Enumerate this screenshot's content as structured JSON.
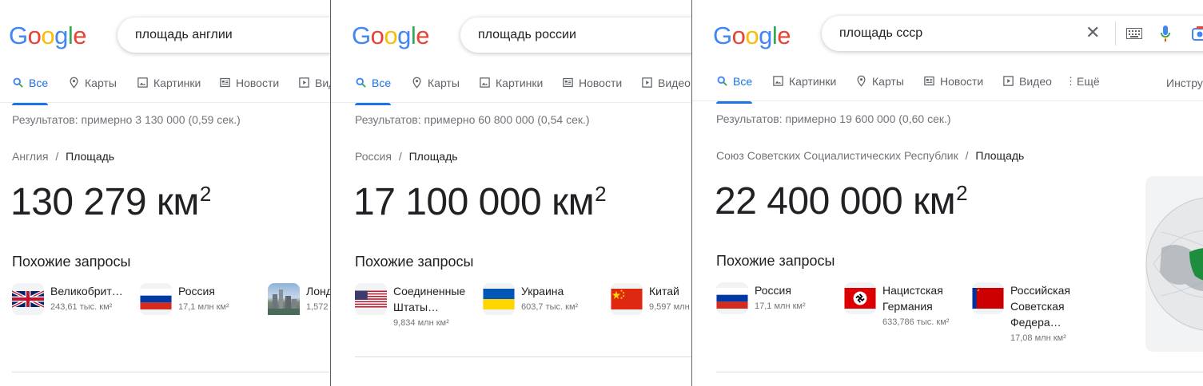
{
  "logo": {
    "letters": [
      "G",
      "o",
      "o",
      "g",
      "l",
      "e"
    ],
    "colors": [
      "#4285F4",
      "#EA4335",
      "#FBBC05",
      "#4285F4",
      "#34A853",
      "#EA4335"
    ]
  },
  "panels": [
    {
      "query": "площадь англии",
      "tabs": [
        "Все",
        "Карты",
        "Картинки",
        "Новости",
        "Вид"
      ],
      "results": "Результатов: примерно 3 130 000 (0,59 сек.)",
      "crumb_parent": "Англия",
      "crumb_sep": "/",
      "crumb_current": "Площадь",
      "value": "130 279 км",
      "value_sup": "2",
      "related_title": "Похожие запросы",
      "related": [
        {
          "name": "Великобрит…",
          "value": "243,61 тыс. км²",
          "icon": "uk-flag-icon"
        },
        {
          "name": "Россия",
          "value": "17,1 млн км²",
          "icon": "russia-flag-icon"
        },
        {
          "name": "Лонд",
          "value": "1,572",
          "icon": "london-photo-icon"
        }
      ]
    },
    {
      "query": "площадь россии",
      "tabs": [
        "Все",
        "Карты",
        "Картинки",
        "Новости",
        "Видео"
      ],
      "results": "Результатов: примерно 60 800 000 (0,54 сек.)",
      "crumb_parent": "Россия",
      "crumb_sep": "/",
      "crumb_current": "Площадь",
      "value": "17 100 000 км",
      "value_sup": "2",
      "related_title": "Похожие запросы",
      "related": [
        {
          "name1": "Соединенные",
          "name2": "Штаты…",
          "value": "9,834 млн км²",
          "icon": "usa-flag-icon"
        },
        {
          "name": "Украина",
          "value": "603,7 тыс. км²",
          "icon": "ukraine-flag-icon"
        },
        {
          "name": "Китай",
          "value": "9,597 млн",
          "icon": "china-flag-icon"
        }
      ]
    },
    {
      "query": "площадь ссср",
      "tabs": [
        "Все",
        "Картинки",
        "Карты",
        "Новости",
        "Видео",
        "Ещё"
      ],
      "tools": "Инстру",
      "results": "Результатов: примерно 19 600 000 (0,60 сек.)",
      "crumb_parent": "Союз Советских Социалистических Республик",
      "crumb_sep": "/",
      "crumb_current": "Площадь",
      "value": "22 400 000 км",
      "value_sup": "2",
      "related_title": "Похожие запросы",
      "related": [
        {
          "name": "Россия",
          "value": "17,1 млн км²",
          "icon": "russia-flag-icon"
        },
        {
          "name1": "Нацистская",
          "name2": "Германия",
          "value": "633,786 тыс. км²",
          "icon": "nazi-germany-flag-icon"
        },
        {
          "name1": "Российская",
          "name2": "Советская",
          "name3": "Федера…",
          "value": "17,08 млн км²",
          "icon": "rsfsr-flag-icon"
        }
      ]
    }
  ]
}
